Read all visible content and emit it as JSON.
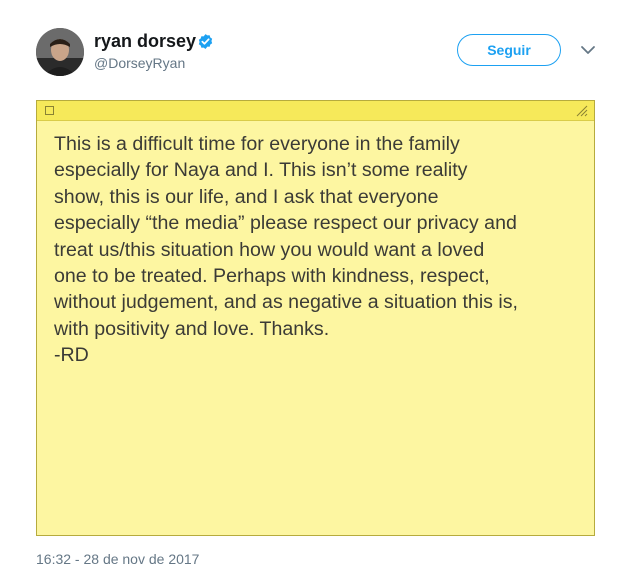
{
  "author": {
    "display_name": "ryan dorsey",
    "handle": "@DorseyRyan",
    "verified_icon": "verified-badge-icon",
    "avatar_icon": "avatar"
  },
  "actions": {
    "follow_label": "Seguir",
    "menu_icon": "chevron-down-icon"
  },
  "note": {
    "text": "This is a difficult time for everyone in the family\nespecially for Naya and I. This isn’t some reality\nshow, this is our life, and I ask that everyone\nespecially “the media” please respect our privacy and\ntreat us/this situation how you would want a loved\none to be treated. Perhaps with kindness, respect,\nwithout judgement, and as negative a situation this is,\nwith positivity and love. Thanks.\n-RD",
    "background_color": "#fdf6a1",
    "bar_color": "#f6e95a"
  },
  "timestamp": "16:32 - 28 de nov de 2017",
  "colors": {
    "accent": "#1da1f2",
    "secondary_text": "#657786",
    "primary_text": "#14171a"
  }
}
